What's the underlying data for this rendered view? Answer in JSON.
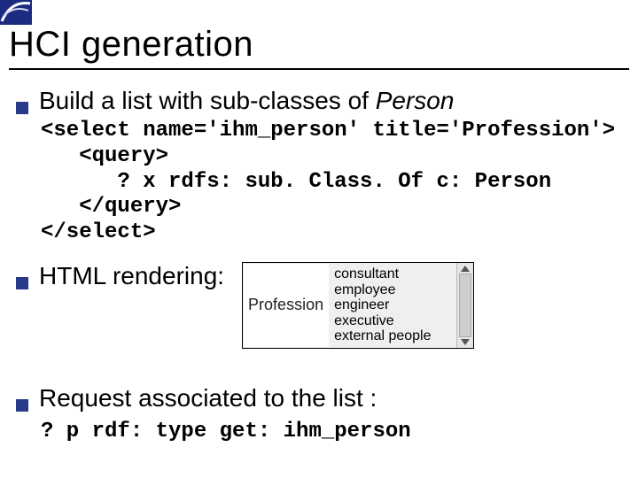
{
  "title": "HCI generation",
  "bullets": {
    "b1_prefix": "Build a list with sub-classes of ",
    "b1_italic": "Person",
    "b2": "HTML rendering:",
    "b3": "Request associated to the list :"
  },
  "code1": "<select name='ihm_person' title='Profession'>\n   <query>\n      ? x rdfs: sub. Class. Of c: Person\n   </query>\n</select>",
  "code2": "? p rdf: type get: ihm_person",
  "widget": {
    "label": "Profession",
    "options": [
      "consultant",
      "employee",
      "engineer",
      "executive",
      "external people"
    ]
  }
}
